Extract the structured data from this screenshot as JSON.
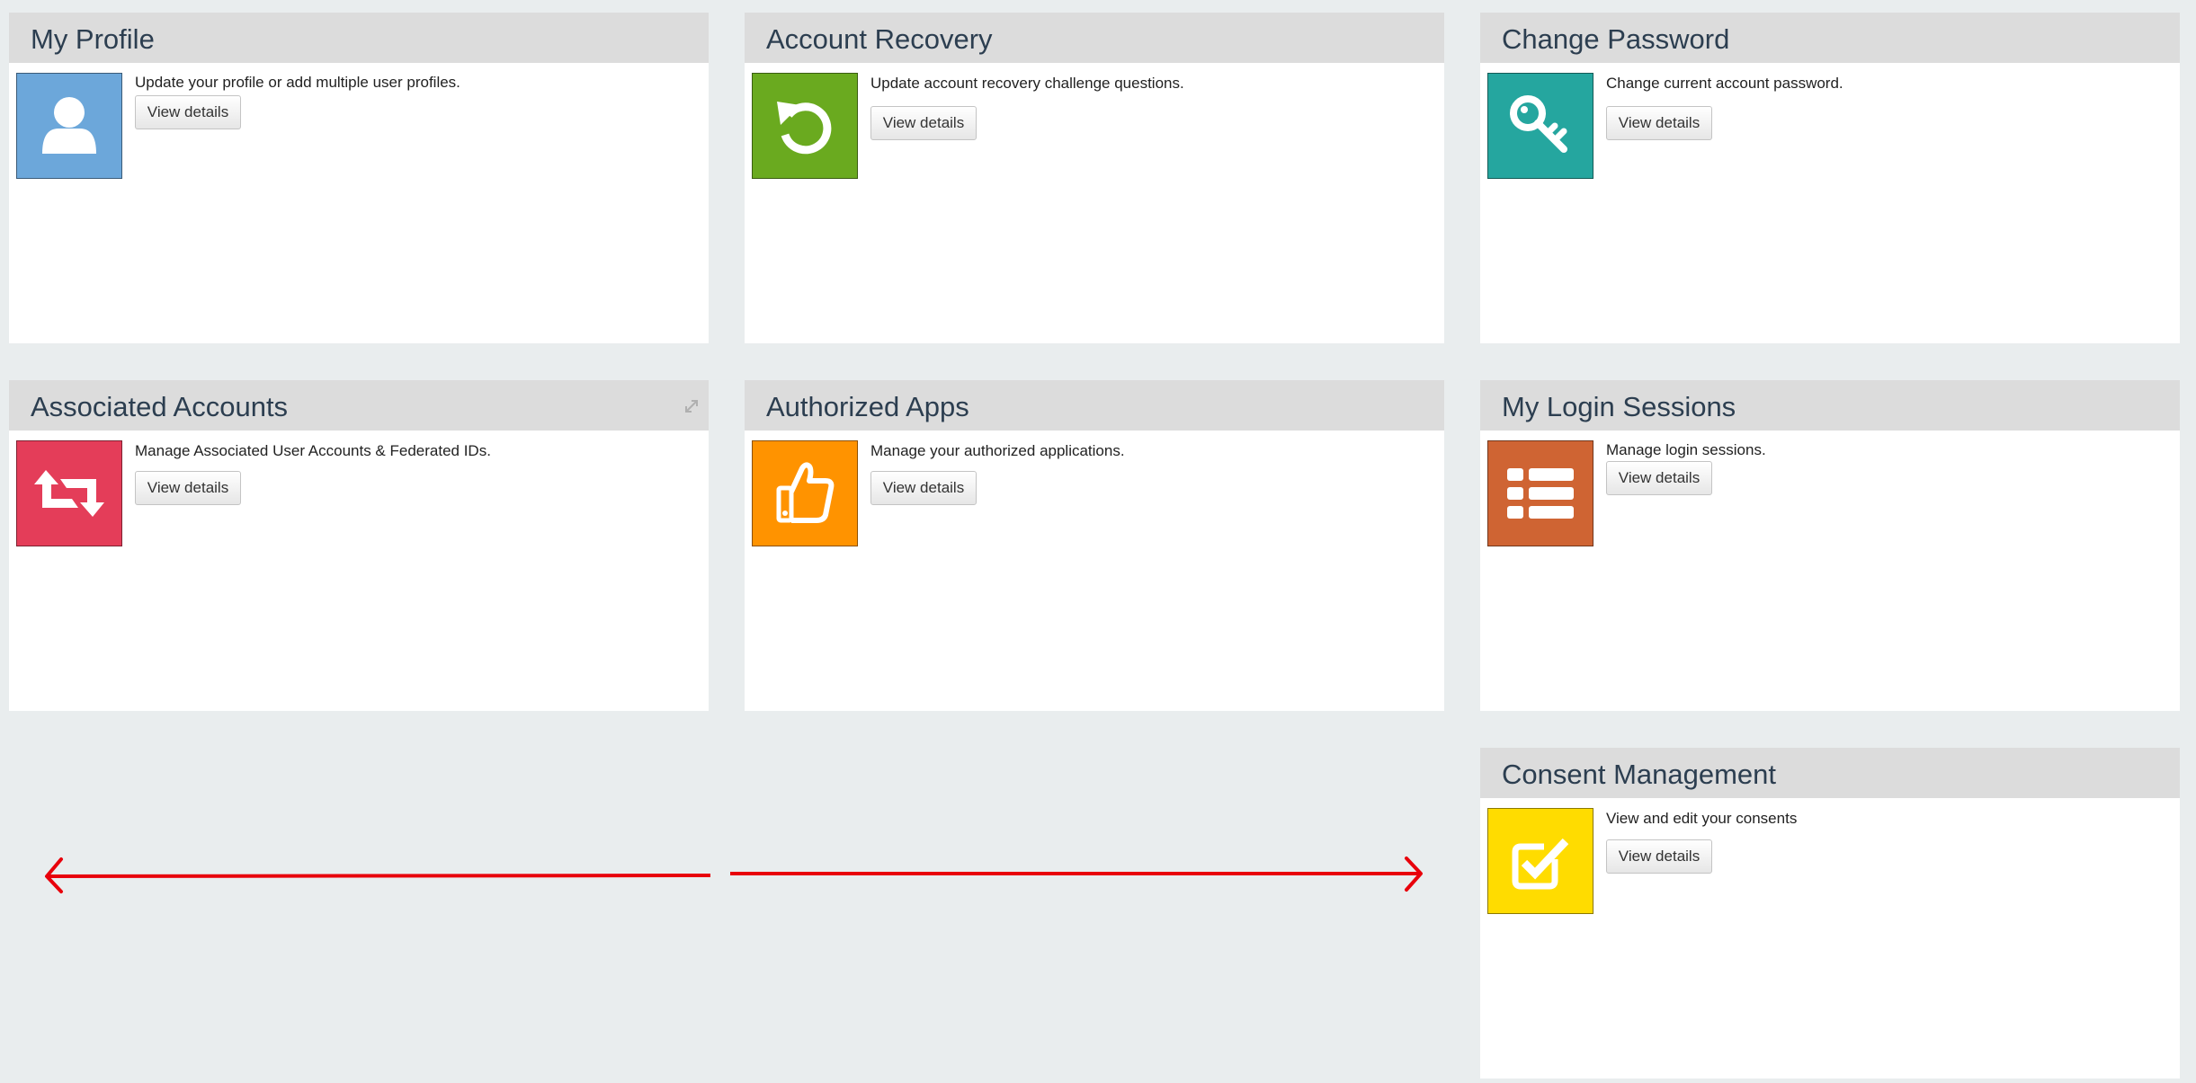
{
  "cards": [
    {
      "title": "My Profile",
      "description": "Update your profile or add multiple user profiles.",
      "button": "View details",
      "icon": "user-icon",
      "color": "#6ca7da"
    },
    {
      "title": "Account Recovery",
      "description": "Update account recovery challenge questions.",
      "button": "View details",
      "icon": "undo-icon",
      "color": "#6aaa1f"
    },
    {
      "title": "Change Password",
      "description": "Change current account password.",
      "button": "View details",
      "icon": "key-icon",
      "color": "#25a69f"
    },
    {
      "title": "Associated Accounts",
      "description": "Manage Associated User Accounts & Federated IDs.",
      "button": "View details",
      "icon": "retweet-icon",
      "color": "#e43d59"
    },
    {
      "title": "Authorized Apps",
      "description": "Manage your authorized applications.",
      "button": "View details",
      "icon": "thumbs-up-icon",
      "color": "#ff9300"
    },
    {
      "title": "My Login Sessions",
      "description": "Manage login sessions.",
      "button": "View details",
      "icon": "list-icon",
      "color": "#cf6433"
    },
    {
      "title": "Consent Management",
      "description": "View and edit your consents",
      "button": "View details",
      "icon": "check-square-icon",
      "color": "#ffdc00"
    }
  ],
  "annotation": {
    "icon": "double-arrow-icon",
    "color": "#e8000b"
  }
}
